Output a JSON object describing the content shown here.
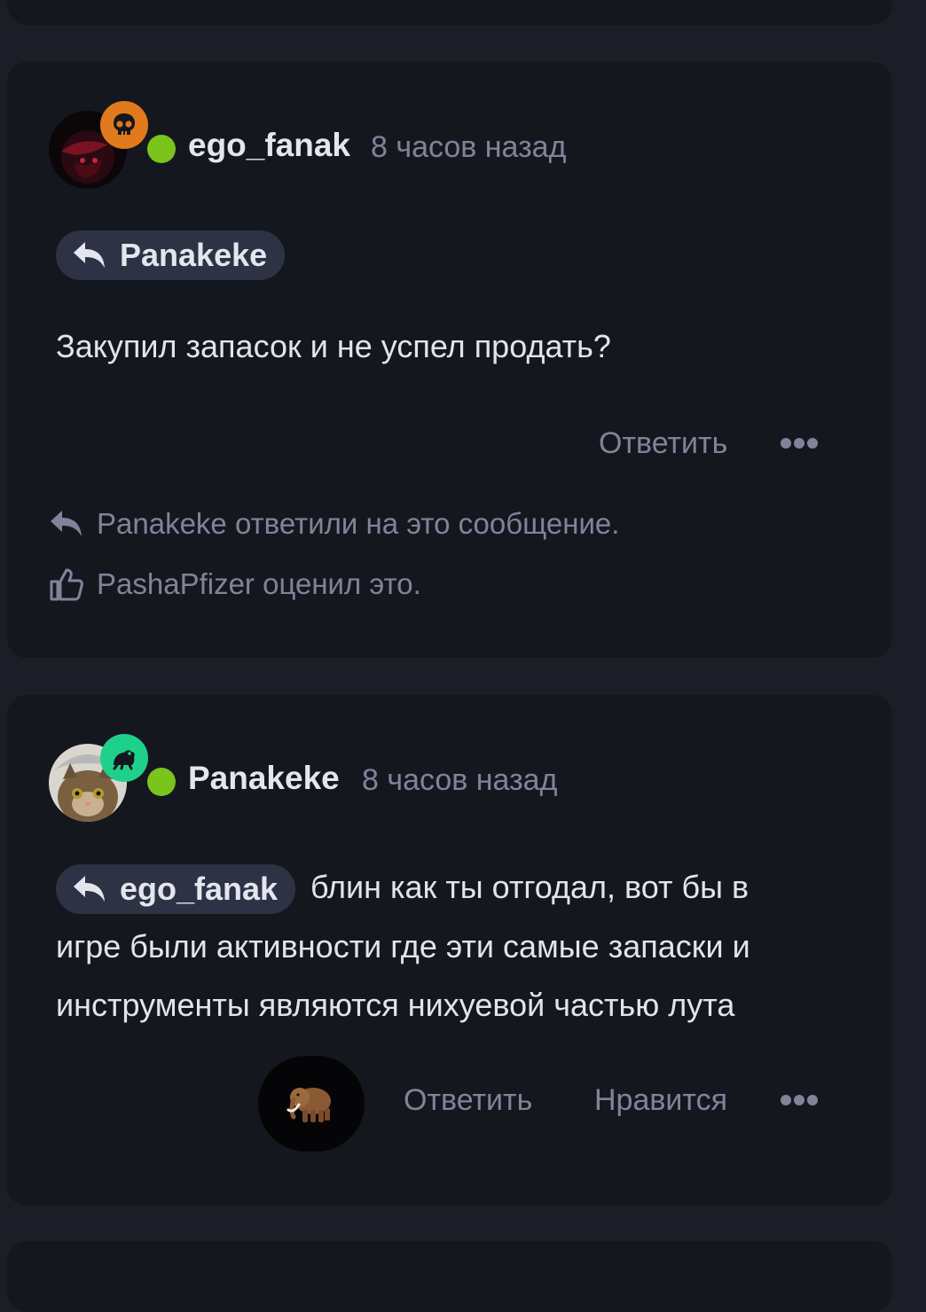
{
  "colors": {
    "page_bg": "#1c1e27",
    "card_bg": "#15171f",
    "online": "#7bc41c",
    "muted_text": "#80849a",
    "primary_text": "#e4e6ee",
    "pill_bg": "#2e3245",
    "badge_skull": "#e07a1d",
    "badge_frog": "#1ed18b"
  },
  "comments": [
    {
      "username": "ego_fanak",
      "timestamp": "8 часов назад",
      "avatar_icon": "dark-red-avatar",
      "badge_icon": "skull-icon",
      "reply_to": "Panakeke",
      "text": "Закупил запасок и не успел продать?",
      "actions": {
        "reply": "Ответить"
      },
      "activity": [
        {
          "icon": "reply-arrow-icon",
          "text": "Panakeke ответили на это сообщение."
        },
        {
          "icon": "thumbs-up-icon",
          "text": "PashaPfizer оценил это."
        }
      ]
    },
    {
      "username": "Panakeke",
      "timestamp": "8 часов назад",
      "avatar_icon": "cat-avatar",
      "badge_icon": "frog-icon",
      "reply_to": "ego_fanak",
      "text_line1": "блин как ты отгодал, вот бы в",
      "text_line2": "игре были активности где эти самые запаски и",
      "text_line3": "инструменты являются нихуевой частью лута",
      "reaction_icon": "mammoth-icon",
      "actions": {
        "reply": "Ответить",
        "like": "Нравится"
      }
    }
  ]
}
